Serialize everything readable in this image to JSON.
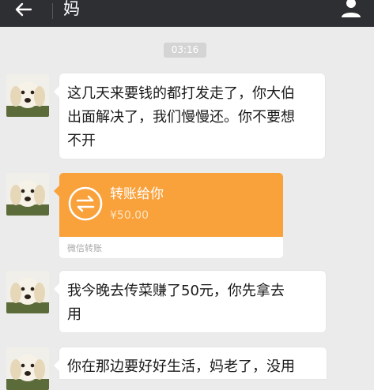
{
  "header": {
    "title": "妈",
    "back_icon": "arrow-left-icon",
    "profile_icon": "person-icon"
  },
  "timestamp": "03:16",
  "messages": [
    {
      "type": "text",
      "text": "这几天来要钱的都打发走了，你大伯\n出面解决了，我们慢慢还。你不要想\n不开"
    },
    {
      "type": "transfer",
      "title": "转账给你",
      "amount": "¥50.00",
      "footer": "微信转账",
      "icon": "transfer-arrows-icon"
    },
    {
      "type": "text",
      "text": "我今晚去传菜赚了50元，你先拿去\n用"
    },
    {
      "type": "text",
      "text": "你在那边要好好生活，妈老了，没用"
    }
  ],
  "colors": {
    "header_bg": "#2e2f33",
    "chat_bg": "#ebebeb",
    "bubble_bg": "#ffffff",
    "transfer_orange": "#f9a13a"
  }
}
